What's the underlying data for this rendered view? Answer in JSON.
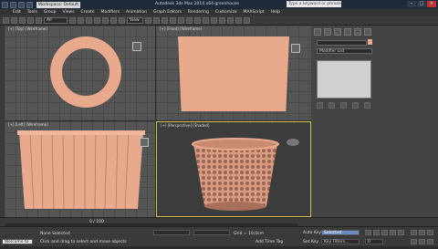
{
  "titlebar": {
    "workspace": "Workspace: Default",
    "title": "Autodesk 3ds Max 2014 x64   greenhouse",
    "search_placeholder": "Type a keyword or phrase"
  },
  "menubar": [
    "Edit",
    "Tools",
    "Group",
    "Views",
    "Create",
    "Modifiers",
    "Animation",
    "Graph Editors",
    "Rendering",
    "Customize",
    "MAXScript",
    "Help"
  ],
  "toolbar": {
    "filter": "All",
    "view": "View"
  },
  "viewports": {
    "top": "[+] [Top] [Wireframe]",
    "front": "[+] [Front] [Wireframe]",
    "left": "[+] [Left] [Wireframe]",
    "perspective": "[+] [Perspective] [Shaded]"
  },
  "command_panel": {
    "object_name": "",
    "modifier_list": "Modifier List"
  },
  "timeline": {
    "frames": "0 / 100"
  },
  "status": {
    "welcome": "Welcome to M",
    "selection": "None Selected",
    "prompt": "Click and drag to select and move objects",
    "add_time_tag": "Add Time Tag",
    "auto_key": "Auto Key",
    "selected": "Selected",
    "set_key": "Set Key",
    "key_filters": "Key Filters...",
    "grid": "Grid = 10,0cm",
    "frame": "0"
  },
  "colors": {
    "object": "#e8a98c",
    "viewport_bg": "#555555",
    "active_border": "#d8c24a"
  }
}
